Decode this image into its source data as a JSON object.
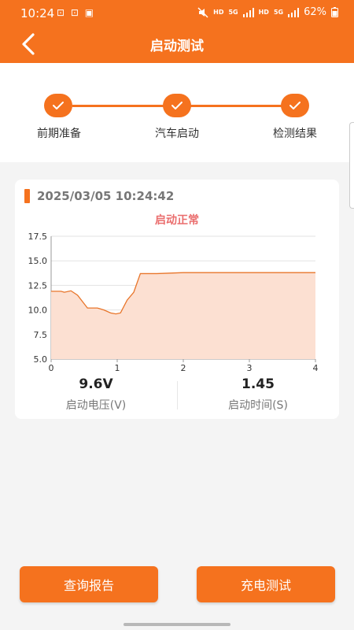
{
  "status_bar": {
    "time": "10:24",
    "left_icons": "⊡ ⊡ ▣",
    "net1": "HD",
    "net2": "HD",
    "sig_label": "5G",
    "battery": "62%"
  },
  "nav": {
    "title": "启动测试"
  },
  "steps": [
    {
      "label": "前期准备",
      "done": true
    },
    {
      "label": "汽车启动",
      "done": true
    },
    {
      "label": "检测结果",
      "done": true
    }
  ],
  "result": {
    "datetime": "2025/03/05 10:24:42",
    "status": "启动正常",
    "voltage_value": "9.6V",
    "voltage_label": "启动电压(V)",
    "time_value": "1.45",
    "time_label": "启动时间(S)"
  },
  "chart_data": {
    "type": "area",
    "x": [
      0,
      0.15,
      0.2,
      0.3,
      0.4,
      0.55,
      0.7,
      0.8,
      0.9,
      0.98,
      1.05,
      1.15,
      1.25,
      1.35,
      1.6,
      2.0,
      3.0,
      4.0
    ],
    "y": [
      11.9,
      11.9,
      11.8,
      11.95,
      11.5,
      10.2,
      10.2,
      10.0,
      9.7,
      9.6,
      9.7,
      11.0,
      11.8,
      13.7,
      13.7,
      13.8,
      13.8,
      13.8
    ],
    "x_ticks": [
      "0",
      "1",
      "2",
      "3",
      "4"
    ],
    "y_ticks": [
      "17.5",
      "15.0",
      "12.5",
      "10.0",
      "7.5",
      "5.0"
    ],
    "xlim": [
      0,
      4
    ],
    "ylim": [
      5,
      17.5
    ],
    "grid": true,
    "line_color": "#e8752a",
    "fill_color": "#fce0d2"
  },
  "buttons": {
    "report": "查询报告",
    "charge": "充电测试"
  },
  "colors": {
    "accent": "#f5721e",
    "status_ok": "#ea6d6d"
  }
}
